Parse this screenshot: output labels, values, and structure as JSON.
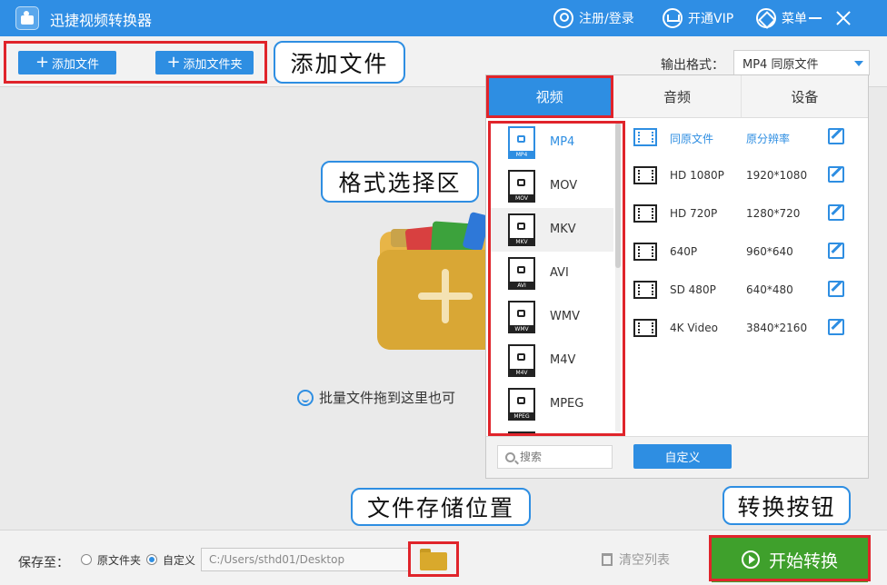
{
  "app": {
    "title": "迅捷视频转换器"
  },
  "titlebar": {
    "login": "注册/登录",
    "vip": "开通VIP",
    "menu": "菜单"
  },
  "toolbar": {
    "add_file": "添加文件",
    "add_folder": "添加文件夹",
    "output_label": "输出格式：",
    "output_value": "MP4  同原文件"
  },
  "callouts": {
    "add_file": "添加文件",
    "format_area": "格式选择区",
    "save_location": "文件存储位置",
    "convert_button": "转换按钮"
  },
  "dropzone": {
    "hint": "批量文件拖到这里也可"
  },
  "format_panel": {
    "tabs": [
      "视频",
      "音频",
      "设备"
    ],
    "formats": [
      {
        "name": "MP4",
        "tag": "MP4"
      },
      {
        "name": "MOV",
        "tag": "MOV"
      },
      {
        "name": "MKV",
        "tag": "MKV"
      },
      {
        "name": "AVI",
        "tag": "AVI"
      },
      {
        "name": "WMV",
        "tag": "WMV"
      },
      {
        "name": "M4V",
        "tag": "M4V"
      },
      {
        "name": "MPEG",
        "tag": "MPEG"
      }
    ],
    "presets": [
      {
        "name": "同原文件",
        "res": "原分辨率"
      },
      {
        "name": "HD 1080P",
        "res": "1920*1080"
      },
      {
        "name": "HD 720P",
        "res": "1280*720"
      },
      {
        "name": "640P",
        "res": "960*640"
      },
      {
        "name": "SD 480P",
        "res": "640*480"
      },
      {
        "name": "4K Video",
        "res": "3840*2160"
      }
    ],
    "search_placeholder": "搜索",
    "custom_button": "自定义"
  },
  "bottombar": {
    "save_label": "保存至：",
    "option_original": "原文件夹",
    "option_custom": "自定义",
    "path": "C:/Users/sthd01/Desktop",
    "clear_list": "清空列表",
    "start": "开始转换"
  },
  "colors": {
    "accent": "#2e8ee2",
    "start": "#3fa02c",
    "annotation": "#e0242b"
  }
}
